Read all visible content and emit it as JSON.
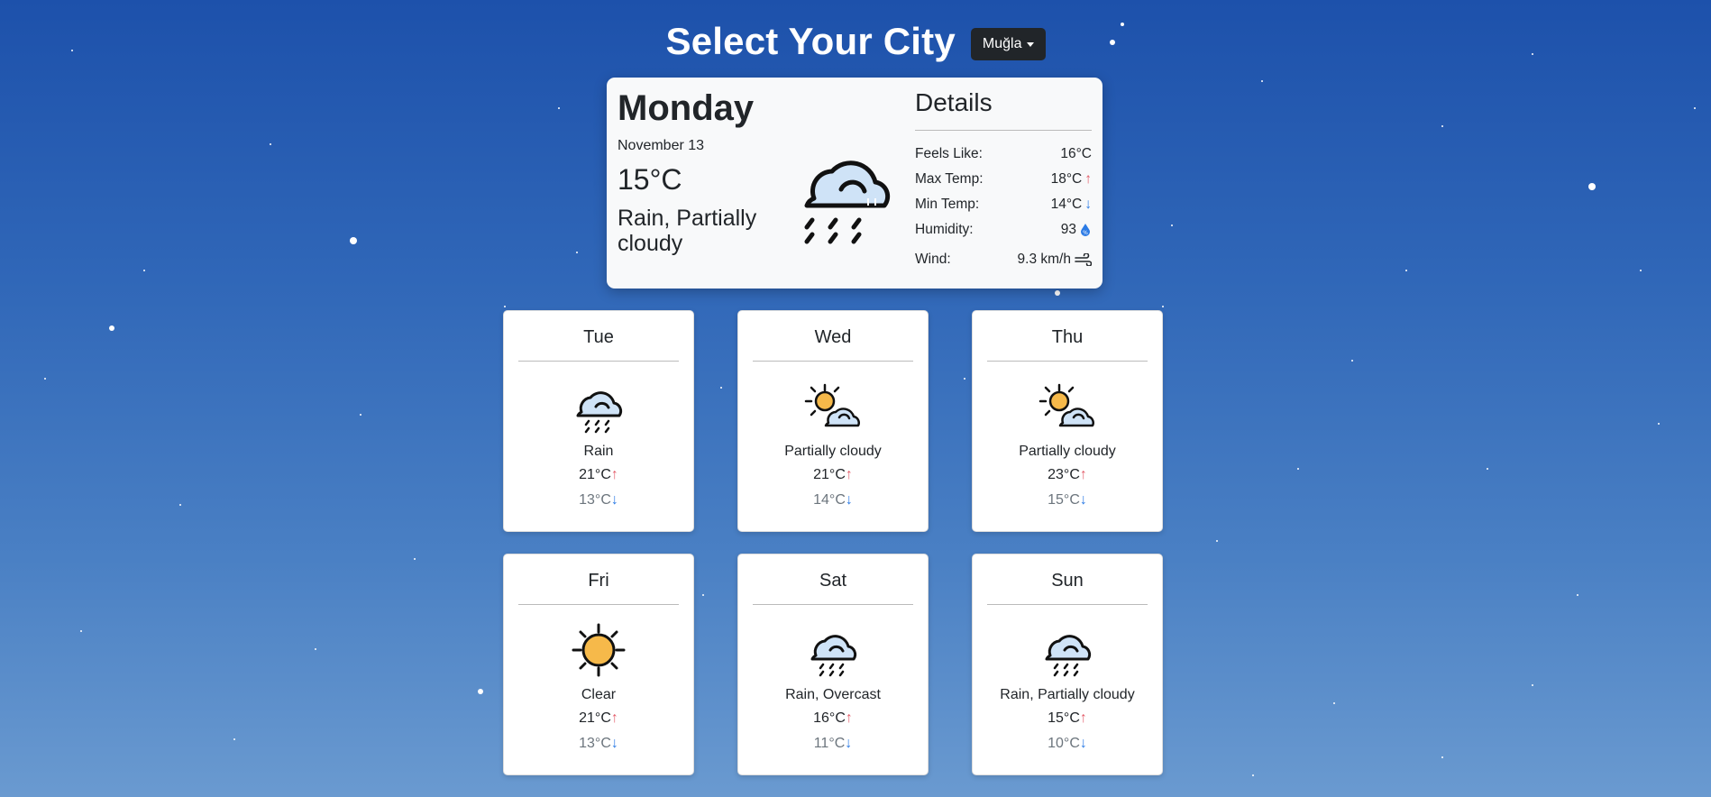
{
  "header": {
    "title": "Select Your City",
    "city": "Muğla"
  },
  "today": {
    "day": "Monday",
    "date": "November 13",
    "temp": "15°C",
    "desc": "Rain, Partially cloudy",
    "icon": "rain-partially-cloudy-icon"
  },
  "details": {
    "title": "Details",
    "rows": [
      {
        "label": "Feels Like:",
        "value": "16°C"
      },
      {
        "label": "Max Temp:",
        "value": "18°C"
      },
      {
        "label": "Min Temp:",
        "value": "14°C"
      },
      {
        "label": "Humidity:",
        "value": "93"
      },
      {
        "label": "Wind:",
        "value": "9.3 km/h"
      }
    ]
  },
  "forecast": [
    {
      "day": "Tue",
      "desc": "Rain",
      "max": "21°C",
      "min": "13°C",
      "icon": "rain"
    },
    {
      "day": "Wed",
      "desc": "Partially cloudy",
      "max": "21°C",
      "min": "14°C",
      "icon": "partly"
    },
    {
      "day": "Thu",
      "desc": "Partially cloudy",
      "max": "23°C",
      "min": "15°C",
      "icon": "partly"
    },
    {
      "day": "Fri",
      "desc": "Clear",
      "max": "21°C",
      "min": "13°C",
      "icon": "sun"
    },
    {
      "day": "Sat",
      "desc": "Rain, Overcast",
      "max": "16°C",
      "min": "11°C",
      "icon": "rain"
    },
    {
      "day": "Sun",
      "desc": "Rain, Partially cloudy",
      "max": "15°C",
      "min": "10°C",
      "icon": "rain"
    }
  ],
  "colors": {
    "up": "#e35d6a",
    "down": "#2c7be5",
    "sun": "#f6b94a",
    "cloud": "#cfe3f7"
  }
}
